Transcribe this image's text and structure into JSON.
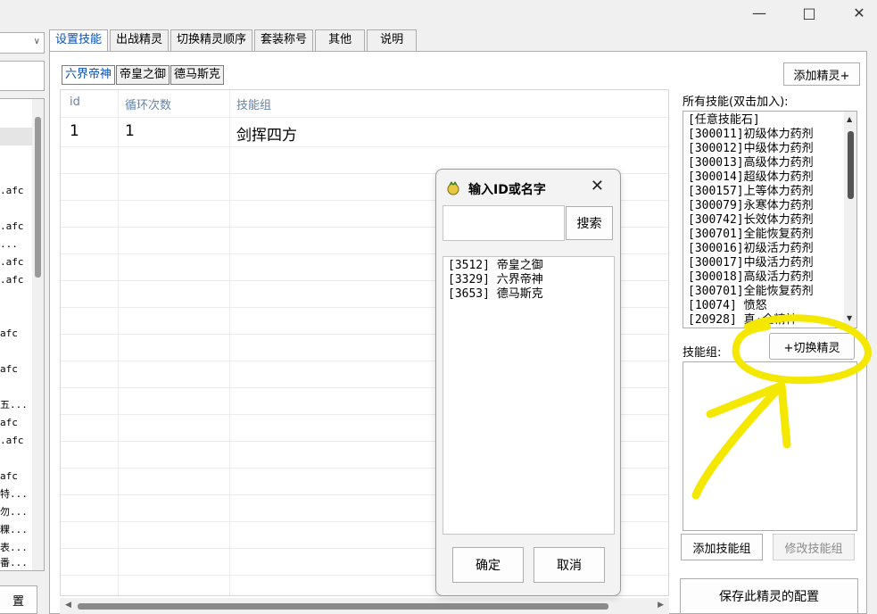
{
  "window": {
    "minimize_icon": "minimize-icon",
    "maximize_icon": "maximize-icon",
    "close_icon": "close-icon"
  },
  "left_panel": {
    "rows": [
      ".afc",
      ".afc",
      "...",
      ".afc",
      ".afc",
      "afc",
      "afc",
      "五...",
      "afc",
      ".afc",
      "afc",
      "特...",
      "勿...",
      "粿...",
      "表...",
      "番..."
    ],
    "bottom_button": "置"
  },
  "tabs": [
    "设置技能",
    "出战精灵",
    "切换精灵顺序",
    "套装称号",
    "其他",
    "说明"
  ],
  "sprite_tabs": [
    "六界帝神",
    "帝皇之御",
    "德马斯克"
  ],
  "add_sprite_label": "添加精灵+",
  "grid": {
    "columns": [
      "id",
      "循环次数",
      "技能组"
    ],
    "rows": [
      {
        "id": "1",
        "loops": "1",
        "group": "剑挥四方"
      }
    ]
  },
  "skills": {
    "title": "所有技能(双击加入):",
    "items": [
      "[任意技能石]",
      "[300011]初级体力药剂",
      "[300012]中级体力药剂",
      "[300013]高级体力药剂",
      "[300014]超级体力药剂",
      "[300157]上等体力药剂",
      "[300079]永寒体力药剂",
      "[300742]长效体力药剂",
      "[300701]全能恢复药剂",
      "[300016]初级活力药剂",
      "[300017]中级活力药剂",
      "[300018]高级活力药剂",
      "[300701]全能恢复药剂",
      "[10074] 愤怒",
      "[20928] 真·全精神"
    ]
  },
  "skill_group_label": "技能组:",
  "switch_sprite_label": "+切换精灵",
  "add_group_label": "添加技能组",
  "edit_group_label": "修改技能组",
  "save_label": "保存此精灵的配置",
  "dialog": {
    "title": "输入ID或名字",
    "input_value": "",
    "search_label": "搜索",
    "results": [
      "[3512] 帝皇之御",
      "[3329] 六界帝神",
      "[3653] 德马斯克"
    ],
    "ok_label": "确定",
    "cancel_label": "取消"
  },
  "annotation_color": "#f5e800"
}
